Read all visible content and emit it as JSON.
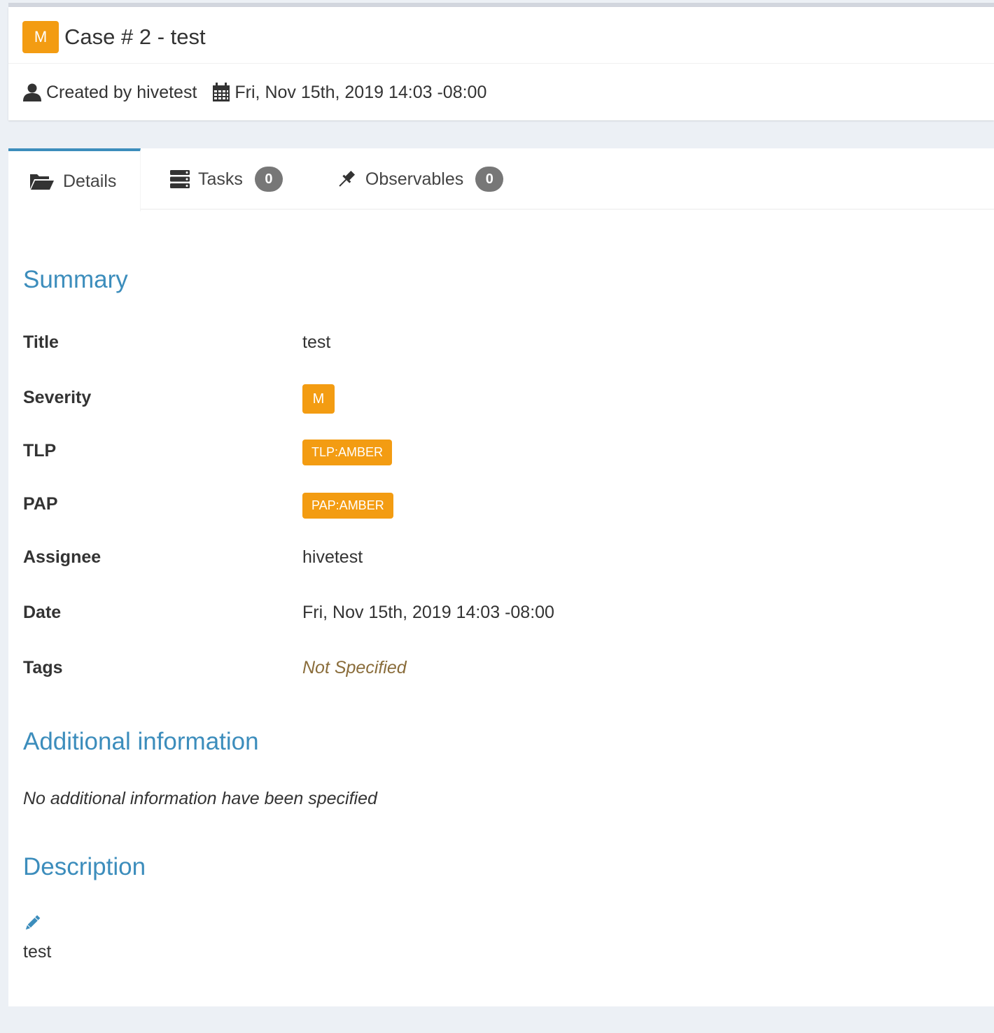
{
  "header": {
    "severity": "M",
    "title": "Case # 2 - test",
    "created_by": "Created by hivetest",
    "created_date": "Fri, Nov 15th, 2019 14:03 -08:00"
  },
  "tabs": [
    {
      "label": "Details",
      "icon": "folder-open-icon",
      "active": true
    },
    {
      "label": "Tasks",
      "icon": "tasks-icon",
      "count": "0"
    },
    {
      "label": "Observables",
      "icon": "pin-icon",
      "count": "0"
    }
  ],
  "summary": {
    "heading": "Summary",
    "title_label": "Title",
    "title_value": "test",
    "severity_label": "Severity",
    "severity_value": "M",
    "tlp_label": "TLP",
    "tlp_value": "TLP:AMBER",
    "pap_label": "PAP",
    "pap_value": "PAP:AMBER",
    "assignee_label": "Assignee",
    "assignee_value": "hivetest",
    "date_label": "Date",
    "date_value": "Fri, Nov 15th, 2019 14:03 -08:00",
    "tags_label": "Tags",
    "tags_value": "Not Specified"
  },
  "additional": {
    "heading": "Additional information",
    "note": "No additional information have been specified"
  },
  "description": {
    "heading": "Description",
    "text": "test"
  },
  "colors": {
    "accent": "#3c8dbc",
    "amber": "#f39c12",
    "badge_gray": "#777777",
    "background": "#ecf0f5"
  }
}
